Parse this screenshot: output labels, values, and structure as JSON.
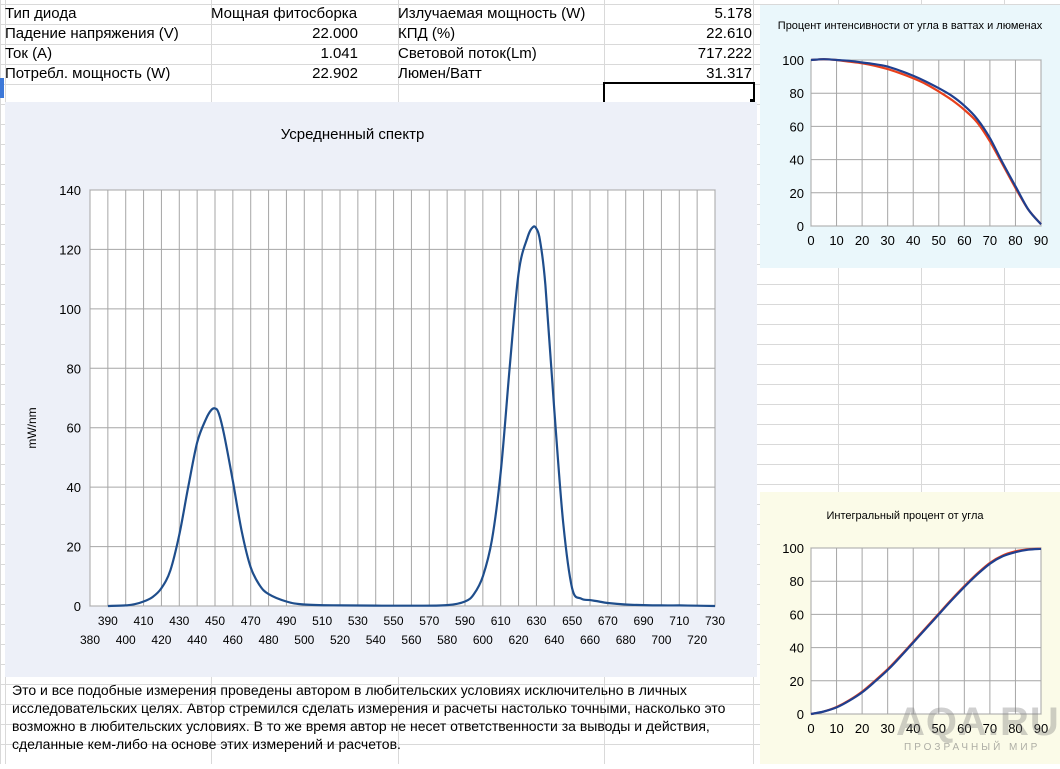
{
  "table": {
    "rows": [
      {
        "label": "Тип диода",
        "value": "Мощная фитосборка",
        "label2": "Излучаемая мощность (W)",
        "value2": "5.178"
      },
      {
        "label": "Падение напряжения (V)",
        "value": "22.000",
        "label2": "КПД (%)",
        "value2": "22.610"
      },
      {
        "label": "Ток (A)",
        "value": "1.041",
        "label2": "Световой поток(Lm)",
        "value2": "717.222"
      },
      {
        "label": "Потребл. мощность (W)",
        "value": "22.902",
        "label2": "Люмен/Ватт",
        "value2": "31.317"
      }
    ]
  },
  "note": "Это и все подобные  измерения проведены автором в любительских условиях исключительно в личных исследовательских целях. Автор стремился сделать измерения и расчеты настолько точными, насколько это возможно в любительских условиях. В то же время автор не несет ответственности за выводы и действия, сделанные кем-либо на основе этих измерений и расчетов.",
  "watermark": {
    "main": "AQA.RU",
    "sub": "ПРОЗРАЧНЫЙ МИР"
  },
  "colors": {
    "spectrum_line": "#1f4e8c",
    "grid": "#a6a6a6",
    "series_blue": "#1f3f8f",
    "series_red": "#e8401c",
    "selection": "#000000"
  },
  "chart_data": [
    {
      "type": "line",
      "title": "Усредненный спектр",
      "xlabel": "",
      "ylabel": "mW/nm",
      "ylim": [
        0,
        140
      ],
      "xlim": [
        380,
        730
      ],
      "x_ticks_top": [
        "390",
        "410",
        "430",
        "450",
        "470",
        "490",
        "510",
        "530",
        "550",
        "570",
        "590",
        "610",
        "630",
        "650",
        "670",
        "690",
        "710",
        "730"
      ],
      "x_ticks_bottom": [
        "380",
        "400",
        "420",
        "440",
        "460",
        "480",
        "500",
        "520",
        "540",
        "560",
        "580",
        "600",
        "620",
        "640",
        "660",
        "680",
        "700",
        "720"
      ],
      "y_ticks": [
        "0",
        "20",
        "40",
        "60",
        "80",
        "100",
        "120",
        "140"
      ],
      "grid": true,
      "series": [
        {
          "x": [
            390,
            400,
            405,
            410,
            415,
            420,
            425,
            430,
            435,
            440,
            445,
            448,
            450,
            452,
            455,
            460,
            465,
            470,
            475,
            480,
            490,
            500,
            520,
            560,
            580,
            590,
            595,
            600,
            605,
            610,
            615,
            620,
            625,
            628,
            630,
            632,
            635,
            640,
            645,
            650,
            655,
            660,
            665,
            670,
            680,
            690,
            700,
            710,
            720,
            730
          ],
          "y": [
            0,
            0.2,
            0.6,
            1.5,
            3,
            6,
            12,
            24,
            40,
            55,
            63,
            66,
            66.5,
            65,
            58,
            42,
            25,
            13,
            7,
            4,
            1.5,
            0.5,
            0.2,
            0.1,
            0.3,
            1.5,
            4,
            10,
            22,
            45,
            80,
            112,
            124,
            127.5,
            127,
            123,
            108,
            66,
            28,
            6,
            2.5,
            2,
            1.5,
            1,
            0.5,
            0.3,
            0.2,
            0.2,
            0.1,
            0
          ]
        }
      ]
    },
    {
      "type": "line",
      "title": "Процент интенсивности от угла в ваттах и люменах",
      "xlabel": "",
      "ylabel": "",
      "xlim": [
        0,
        90
      ],
      "ylim": [
        0,
        100
      ],
      "x_ticks": [
        "0",
        "10",
        "20",
        "30",
        "40",
        "50",
        "60",
        "70",
        "80",
        "90"
      ],
      "y_ticks": [
        "0",
        "20",
        "40",
        "60",
        "80",
        "100"
      ],
      "grid": true,
      "series": [
        {
          "color": "#1f3f8f",
          "x": [
            0,
            5,
            10,
            15,
            20,
            25,
            30,
            35,
            40,
            45,
            50,
            55,
            60,
            65,
            70,
            75,
            80,
            85,
            90
          ],
          "y": [
            100,
            100.5,
            100,
            99.5,
            98.5,
            97.5,
            96,
            93.5,
            90.5,
            87,
            83,
            78.5,
            72.5,
            64.5,
            53,
            38,
            24,
            10,
            1
          ]
        },
        {
          "color": "#e8401c",
          "x": [
            0,
            5,
            10,
            15,
            20,
            25,
            30,
            35,
            40,
            45,
            50,
            55,
            60,
            65,
            70,
            75,
            80,
            85,
            90
          ],
          "y": [
            100,
            100.5,
            100,
            99,
            98,
            96.5,
            94.5,
            92,
            89,
            85.5,
            81,
            76,
            70,
            62.5,
            51,
            37,
            23,
            10,
            1
          ]
        }
      ]
    },
    {
      "type": "line",
      "title": "Интегральный процент от угла",
      "xlabel": "",
      "ylabel": "",
      "xlim": [
        0,
        90
      ],
      "ylim": [
        0,
        100
      ],
      "x_ticks": [
        "0",
        "10",
        "20",
        "30",
        "40",
        "50",
        "60",
        "70",
        "80",
        "90"
      ],
      "y_ticks": [
        "0",
        "20",
        "40",
        "60",
        "80",
        "100"
      ],
      "grid": true,
      "series": [
        {
          "color": "#1f3f8f",
          "x": [
            0,
            5,
            10,
            15,
            20,
            25,
            30,
            35,
            40,
            45,
            50,
            55,
            60,
            65,
            70,
            75,
            80,
            85,
            90
          ],
          "y": [
            0,
            1.5,
            4,
            8,
            13,
            19.5,
            26.5,
            34.5,
            43,
            51.5,
            60,
            68.5,
            76.5,
            84,
            90.5,
            95,
            97.5,
            99,
            99.5
          ]
        },
        {
          "color": "#e8401c",
          "x": [
            0,
            5,
            10,
            15,
            20,
            25,
            30,
            35,
            40,
            45,
            50,
            55,
            60,
            65,
            70,
            75,
            80,
            85,
            90
          ],
          "y": [
            0,
            1.5,
            4.2,
            8.3,
            13.5,
            20,
            27,
            35,
            43.5,
            52,
            60.5,
            69,
            77,
            84.5,
            91,
            95.5,
            98,
            99.2,
            99.6
          ]
        }
      ]
    }
  ]
}
